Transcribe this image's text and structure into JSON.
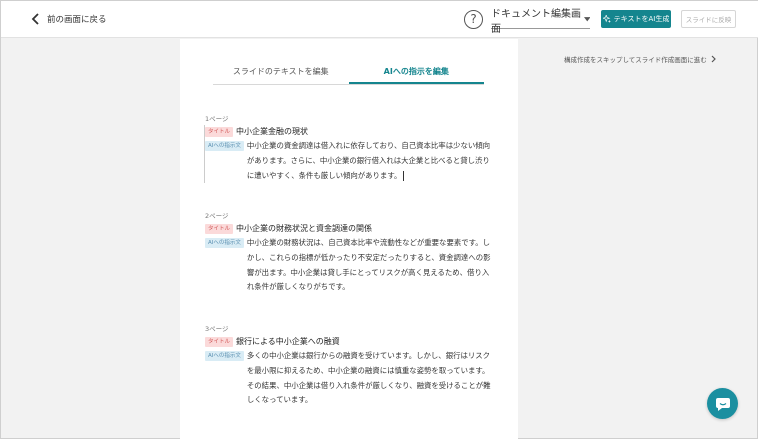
{
  "header": {
    "back_label": "前の画面に戻る",
    "help_glyph": "?",
    "mode_select_value": "ドキュメント編集画面",
    "ai_generate_label": "テキストをAI生成",
    "reflect_label": "スライドに反映"
  },
  "tabs": [
    {
      "label": "スライドのテキストを編集",
      "active": false
    },
    {
      "label": "AIへの指示を編集",
      "active": true
    }
  ],
  "skip_link": "構成作成をスキップしてスライド作成画面に進む",
  "badges": {
    "title": "タイトル",
    "instruction": "AIへの指示文"
  },
  "pages": [
    {
      "page_label": "1ページ",
      "title": "中小企業金融の現状",
      "instruction": "中小企業の資金調達は借入れに依存しており、自己資本比率は少ない傾向があります。さらに、中小企業の銀行借入れは大企業と比べると貸し渋りに遭いやすく、条件も厳しい傾向があります。"
    },
    {
      "page_label": "2ページ",
      "title": "中小企業の財務状況と資金調達の関係",
      "instruction": "中小企業の財務状況は、自己資本比率や流動性などが重要な要素です。しかし、これらの指標が低かったり不安定だったりすると、資金調達への影響が出ます。中小企業は貸し手にとってリスクが高く見えるため、借り入れ条件が厳しくなりがちです。"
    },
    {
      "page_label": "3ページ",
      "title": "銀行による中小企業への融資",
      "instruction": "多くの中小企業は銀行からの融資を受けています。しかし、銀行はリスクを最小限に抑えるため、中小企業の融資には慎重な姿勢を取っています。その結果、中小企業は借り入れ条件が厳しくなり、融資を受けることが難しくなっています。"
    }
  ],
  "colors": {
    "accent": "#14858e",
    "chat": "#1b8fa0"
  },
  "icons": {
    "back": "chevron-left-icon",
    "select": "caret-down-icon",
    "ai": "sparkle-icon",
    "skip": "chevron-right-icon",
    "chat": "chat-bubble-icon"
  }
}
